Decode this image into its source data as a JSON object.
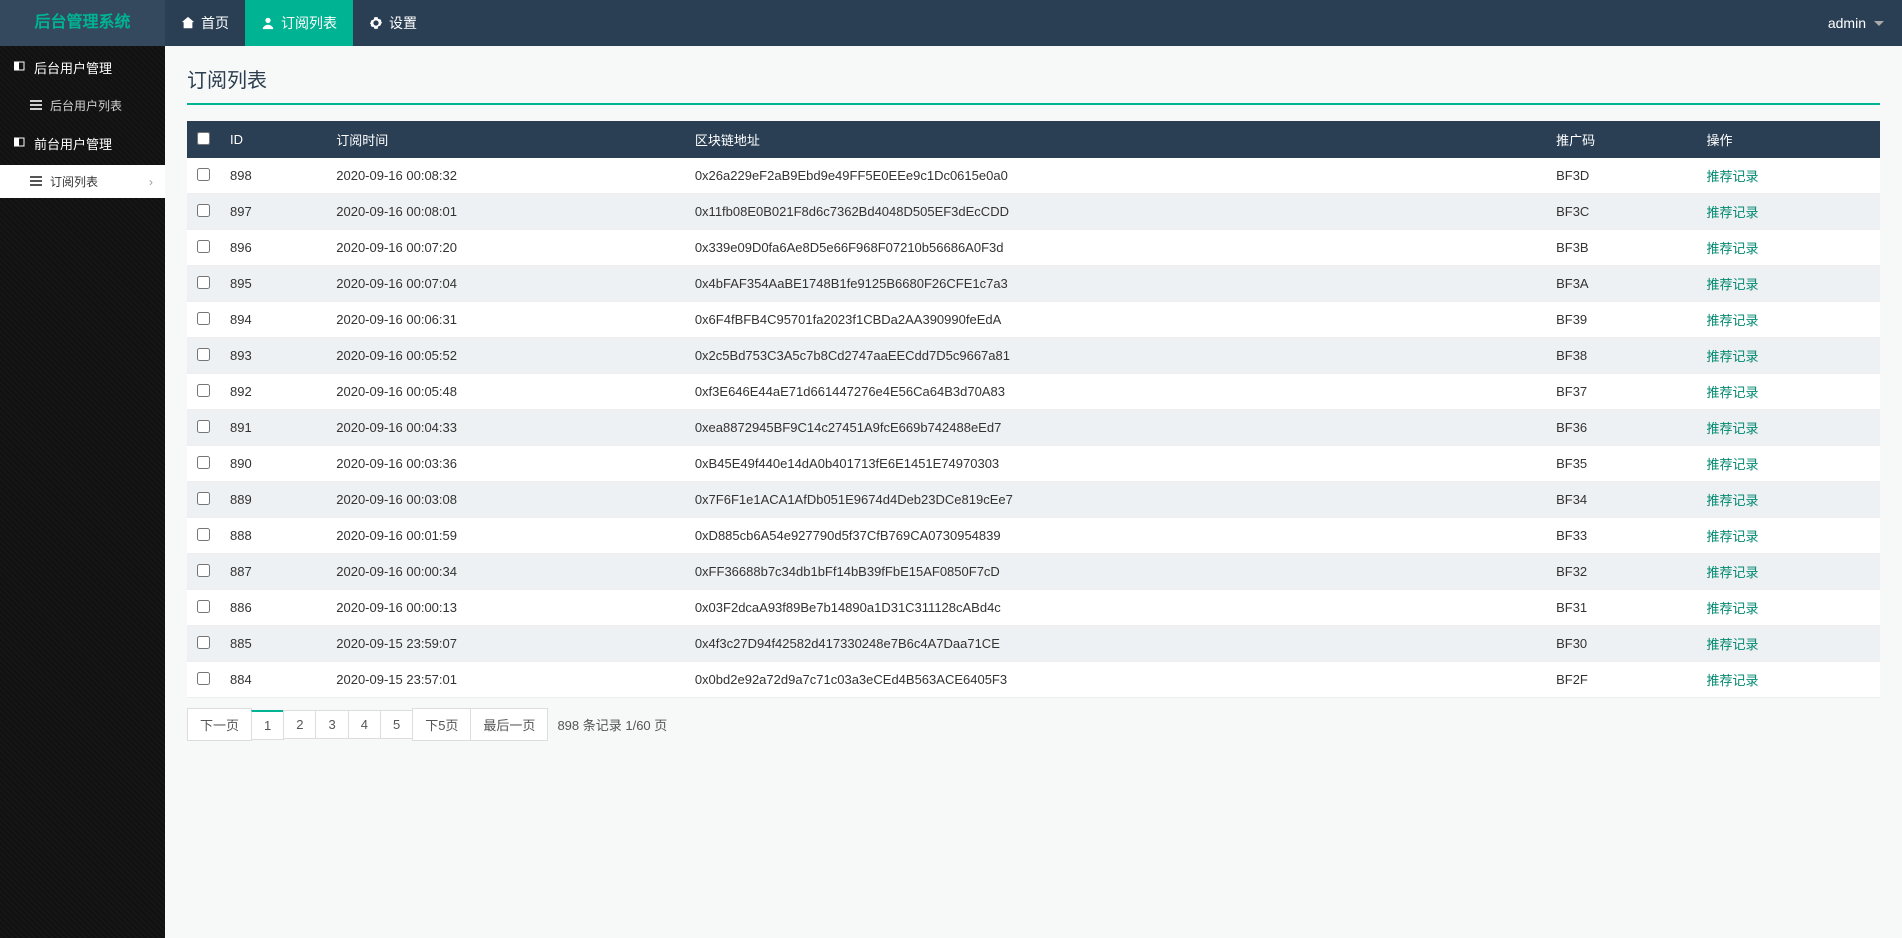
{
  "header": {
    "brand": "后台管理系统",
    "nav": [
      {
        "key": "home",
        "label": "首页",
        "icon": "home",
        "active": false
      },
      {
        "key": "subscriptions",
        "label": "订阅列表",
        "icon": "user",
        "active": true
      },
      {
        "key": "settings",
        "label": "设置",
        "icon": "gear",
        "active": false
      }
    ],
    "user": "admin"
  },
  "sidebar": {
    "groups": [
      {
        "label": "后台用户管理",
        "items": [
          {
            "label": "后台用户列表",
            "active": false
          }
        ]
      },
      {
        "label": "前台用户管理",
        "items": [
          {
            "label": "订阅列表",
            "active": true
          }
        ]
      }
    ]
  },
  "page": {
    "title": "订阅列表"
  },
  "table": {
    "columns": [
      "ID",
      "订阅时间",
      "区块链地址",
      "推广码",
      "操作"
    ],
    "action_label": "推荐记录",
    "rows": [
      {
        "id": "898",
        "time": "2020-09-16 00:08:32",
        "addr": "0x26a229eF2aB9Ebd9e49FF5E0EEe9c1Dc0615e0a0",
        "code": "BF3D"
      },
      {
        "id": "897",
        "time": "2020-09-16 00:08:01",
        "addr": "0x11fb08E0B021F8d6c7362Bd4048D505EF3dEcCDD",
        "code": "BF3C"
      },
      {
        "id": "896",
        "time": "2020-09-16 00:07:20",
        "addr": "0x339e09D0fa6Ae8D5e66F968F07210b56686A0F3d",
        "code": "BF3B"
      },
      {
        "id": "895",
        "time": "2020-09-16 00:07:04",
        "addr": "0x4bFAF354AaBE1748B1fe9125B6680F26CFE1c7a3",
        "code": "BF3A"
      },
      {
        "id": "894",
        "time": "2020-09-16 00:06:31",
        "addr": "0x6F4fBFB4C95701fa2023f1CBDa2AA390990feEdA",
        "code": "BF39"
      },
      {
        "id": "893",
        "time": "2020-09-16 00:05:52",
        "addr": "0x2c5Bd753C3A5c7b8Cd2747aaEECdd7D5c9667a81",
        "code": "BF38"
      },
      {
        "id": "892",
        "time": "2020-09-16 00:05:48",
        "addr": "0xf3E646E44aE71d661447276e4E56Ca64B3d70A83",
        "code": "BF37"
      },
      {
        "id": "891",
        "time": "2020-09-16 00:04:33",
        "addr": "0xea8872945BF9C14c27451A9fcE669b742488eEd7",
        "code": "BF36"
      },
      {
        "id": "890",
        "time": "2020-09-16 00:03:36",
        "addr": "0xB45E49f440e14dA0b401713fE6E1451E74970303",
        "code": "BF35"
      },
      {
        "id": "889",
        "time": "2020-09-16 00:03:08",
        "addr": "0x7F6F1e1ACA1AfDb051E9674d4Deb23DCe819cEe7",
        "code": "BF34"
      },
      {
        "id": "888",
        "time": "2020-09-16 00:01:59",
        "addr": "0xD885cb6A54e927790d5f37CfB769CA0730954839",
        "code": "BF33"
      },
      {
        "id": "887",
        "time": "2020-09-16 00:00:34",
        "addr": "0xFF36688b7c34db1bFf14bB39fFbE15AF0850F7cD",
        "code": "BF32"
      },
      {
        "id": "886",
        "time": "2020-09-16 00:00:13",
        "addr": "0x03F2dcaA93f89Be7b14890a1D31C311128cABd4c",
        "code": "BF31"
      },
      {
        "id": "885",
        "time": "2020-09-15 23:59:07",
        "addr": "0x4f3c27D94f42582d417330248e7B6c4A7Daa71CE",
        "code": "BF30"
      },
      {
        "id": "884",
        "time": "2020-09-15 23:57:01",
        "addr": "0x0bd2e92a72d9a7c71c03a3eCEd4B563ACE6405F3",
        "code": "BF2F"
      }
    ]
  },
  "pager": {
    "buttons": [
      {
        "label": "下一页",
        "active": false
      },
      {
        "label": "1",
        "active": true
      },
      {
        "label": "2",
        "active": false
      },
      {
        "label": "3",
        "active": false
      },
      {
        "label": "4",
        "active": false
      },
      {
        "label": "5",
        "active": false
      },
      {
        "label": "下5页",
        "active": false
      },
      {
        "label": "最后一页",
        "active": false
      }
    ],
    "info": "898 条记录 1/60 页"
  }
}
